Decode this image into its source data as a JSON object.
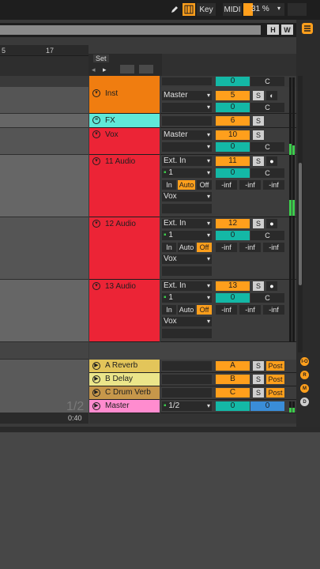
{
  "topbar": {
    "key_label": "Key",
    "midi_label": "MIDI",
    "cpu_percent": "31 %",
    "cpu_fraction": 0.31
  },
  "bar2": {
    "h_label": "H",
    "w_label": "W"
  },
  "ruler": {
    "marks": [
      "5",
      "17"
    ]
  },
  "set": {
    "label": "Set"
  },
  "colors": {
    "orange": "#ff9f1c",
    "inst": "#f07d10",
    "fx": "#5fe8d8",
    "vox": "#ec2436",
    "teal": "#14b8a6",
    "return_a": "#e3c55a",
    "return_b": "#ebe58a",
    "return_c": "#c7974a",
    "master": "#ff8ccf"
  },
  "tracks": [
    {
      "name": "Inst",
      "routing": "Master",
      "number": "5",
      "solo": "S",
      "cue": "C"
    },
    {
      "name": "FX",
      "number": "6",
      "solo": "S"
    },
    {
      "name": "Vox",
      "routing": "Master",
      "number": "10",
      "solo": "S",
      "cue": "C"
    }
  ],
  "audio_tracks": [
    {
      "name": "11 Audio",
      "input": "Ext. In",
      "channel": "1",
      "mon_in": "In",
      "mon_auto": "Auto",
      "mon_off": "Off",
      "out": "Vox",
      "number": "11",
      "solo": "S",
      "cue": "C",
      "meters": [
        "-inf",
        "-inf",
        "-inf"
      ]
    },
    {
      "name": "12 Audio",
      "input": "Ext. In",
      "channel": "1",
      "mon_in": "In",
      "mon_auto": "Auto",
      "mon_off": "Off",
      "out": "Vox",
      "number": "12",
      "solo": "S",
      "cue": "C",
      "meters": [
        "-inf",
        "-inf",
        "-inf"
      ]
    },
    {
      "name": "13 Audio",
      "input": "Ext. In",
      "channel": "1",
      "mon_in": "In",
      "mon_auto": "Auto",
      "mon_off": "Off",
      "out": "Vox",
      "number": "13",
      "solo": "S",
      "cue": "C",
      "meters": [
        "-inf",
        "-inf",
        "-inf"
      ]
    }
  ],
  "returns": [
    {
      "name": "A Reverb",
      "letter": "A",
      "solo": "S",
      "post": "Post"
    },
    {
      "name": "B Delay",
      "letter": "B",
      "solo": "S",
      "post": "Post"
    },
    {
      "name": "C Drum Verb",
      "letter": "C",
      "solo": "S",
      "post": "Post"
    }
  ],
  "master": {
    "name": "Master",
    "cue_out": "1/2",
    "value1": "0",
    "value2": "0"
  },
  "timeline": {
    "time": "0:40",
    "watermark": "1/2"
  },
  "sidebar_dots": [
    "I-O",
    "R",
    "M",
    "D"
  ],
  "mixer_top_cue": "C",
  "mixer_top_number": "0",
  "zero": "0"
}
